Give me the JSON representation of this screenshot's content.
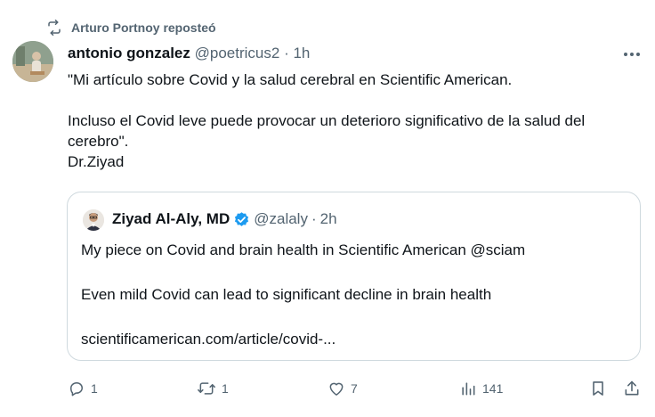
{
  "repost": {
    "text": "Arturo Portnoy reposteó",
    "icon": "repost-icon"
  },
  "post": {
    "author_name": "antonio gonzalez",
    "handle": "@poetricus2",
    "separator": "·",
    "time": "1h",
    "text": "\"Mi artículo sobre Covid y la salud cerebral en Scientific American.\n\nIncluso el Covid leve puede provocar un deterioro significativo de la salud del cerebro\".\nDr.Ziyad"
  },
  "quote": {
    "author_name": "Ziyad Al-Aly, MD",
    "verified_icon": "verified-badge-icon",
    "handle": "@zalaly",
    "separator": "·",
    "time": "2h",
    "line1": "My piece on Covid and brain health in Scientific American @sciam",
    "line2": "Even mild Covid can lead to significant decline in brain health",
    "link": "scientificamerican.com/article/covid-..."
  },
  "actions": {
    "replies": "1",
    "reposts": "1",
    "likes": "7",
    "views": "141"
  },
  "colors": {
    "text": "#0f1419",
    "secondary": "#536471",
    "border": "#cfd9de",
    "verified": "#1d9bf0"
  }
}
